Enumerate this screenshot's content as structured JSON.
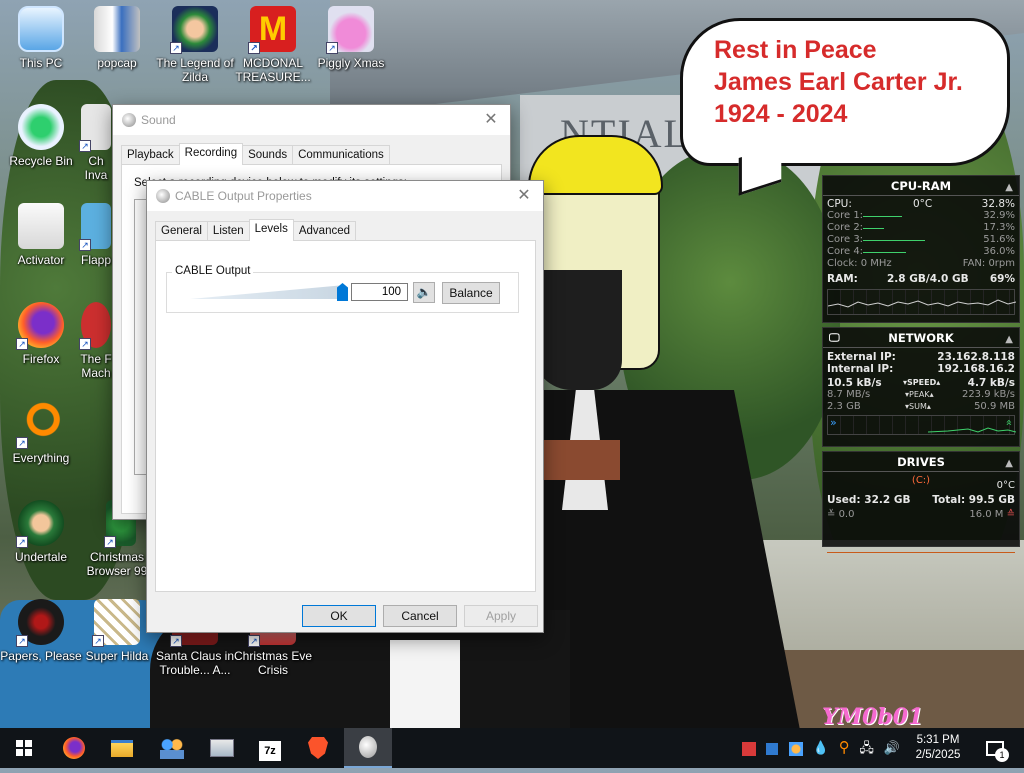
{
  "desktop": {
    "icons": [
      {
        "label": "This PC",
        "icon": "computer-icon"
      },
      {
        "label": "popcap",
        "icon": "folder-icon"
      },
      {
        "label": "The Legend of Zilda",
        "icon": "game-icon"
      },
      {
        "label": "MCDONAL TREASURE...",
        "icon": "mcdonalds-icon"
      },
      {
        "label": "Piggly Xmas",
        "icon": "pig-icon"
      },
      {
        "label": "Recycle Bin",
        "icon": "recycle-bin-icon"
      },
      {
        "label": "Ch Inva",
        "icon": "game-icon"
      },
      {
        "label": "Activator",
        "icon": "document-icon"
      },
      {
        "label": "Flapp",
        "icon": "game-icon"
      },
      {
        "label": "Firefox",
        "icon": "firefox-icon"
      },
      {
        "label": "The F Mach",
        "icon": "game-icon"
      },
      {
        "label": "Everything",
        "icon": "search-icon"
      },
      {
        "label": "Undertale",
        "icon": "undertale-icon"
      },
      {
        "label": "Christmas Browser 99",
        "icon": "game-icon"
      },
      {
        "label": "Papers, Please",
        "icon": "papers-please-icon"
      },
      {
        "label": "Super Hilda",
        "icon": "game-icon"
      },
      {
        "label": "Santa Claus in Trouble... A...",
        "icon": "game-icon"
      },
      {
        "label": "Christmas Eve Crisis",
        "icon": "game-icon"
      }
    ]
  },
  "bubble": {
    "line1": "Rest in Peace",
    "line2": "James Earl Carter Jr.",
    "line3": "1924 - 2024",
    "color": "#d62b2b"
  },
  "wallpaper": {
    "signature": "YM0b01"
  },
  "sound_window": {
    "title": "Sound",
    "tabs": [
      "Playback",
      "Recording",
      "Sounds",
      "Communications"
    ],
    "active_tab": "Recording",
    "instruction": "Select a recording device below to modify its settings:"
  },
  "props_window": {
    "title": "CABLE Output Properties",
    "tabs": [
      "General",
      "Listen",
      "Levels",
      "Advanced"
    ],
    "active_tab": "Levels",
    "group_label": "CABLE Output",
    "level_value": "100",
    "level_fraction": 1.0,
    "balance_label": "Balance",
    "ok_label": "OK",
    "cancel_label": "Cancel",
    "apply_label": "Apply"
  },
  "cpu_ram": {
    "title": "CPU-RAM",
    "cpu_label": "CPU:",
    "cpu_temp": "0°C",
    "cpu_pct": "32.8%",
    "cores": [
      {
        "label": "Core 1:",
        "value": "32.9%",
        "fraction": 0.329
      },
      {
        "label": "Core 2:",
        "value": "17.3%",
        "fraction": 0.173
      },
      {
        "label": "Core 3:",
        "value": "51.6%",
        "fraction": 0.516
      },
      {
        "label": "Core 4:",
        "value": "36.0%",
        "fraction": 0.36
      }
    ],
    "clock": "Clock: 0 MHz",
    "fan": "FAN: 0rpm",
    "ram_label": "RAM:",
    "ram_value": "2.8 GB/4.0 GB",
    "ram_pct": "69%"
  },
  "network": {
    "title": "NETWORK",
    "external_label": "External IP:",
    "external_ip": "23.162.8.118",
    "internal_label": "Internal IP:",
    "internal_ip": "192.168.16.2",
    "speed_down": "10.5 kB/s",
    "speed_label": "SPEED",
    "speed_up": "4.7 kB/s",
    "peak_down": "8.7 MB/s",
    "peak_label": "PEAK",
    "peak_up": "223.9 kB/s",
    "sum_down": "2.3 GB",
    "sum_label": "SUM",
    "sum_up": "50.9 MB"
  },
  "drives": {
    "title": "DRIVES",
    "drive": "(C:)",
    "temp": "0°C",
    "used": "Used: 32.2 GB",
    "total": "Total: 99.5 GB",
    "read": "0.0",
    "write": "16.0 M"
  },
  "taskbar": {
    "apps": [
      {
        "name": "start-button",
        "icon": "windows-logo-icon"
      },
      {
        "name": "firefox",
        "icon": "firefox-icon"
      },
      {
        "name": "file-explorer",
        "icon": "folder-icon"
      },
      {
        "name": "people-app",
        "icon": "people-icon"
      },
      {
        "name": "network-app",
        "icon": "network-computer-icon"
      },
      {
        "name": "7zip",
        "icon": "7zip-icon"
      },
      {
        "name": "brave",
        "icon": "brave-icon"
      },
      {
        "name": "sound-settings",
        "icon": "speaker-icon"
      }
    ],
    "time": "5:31 PM",
    "date": "2/5/2025",
    "notification_count": "1"
  }
}
